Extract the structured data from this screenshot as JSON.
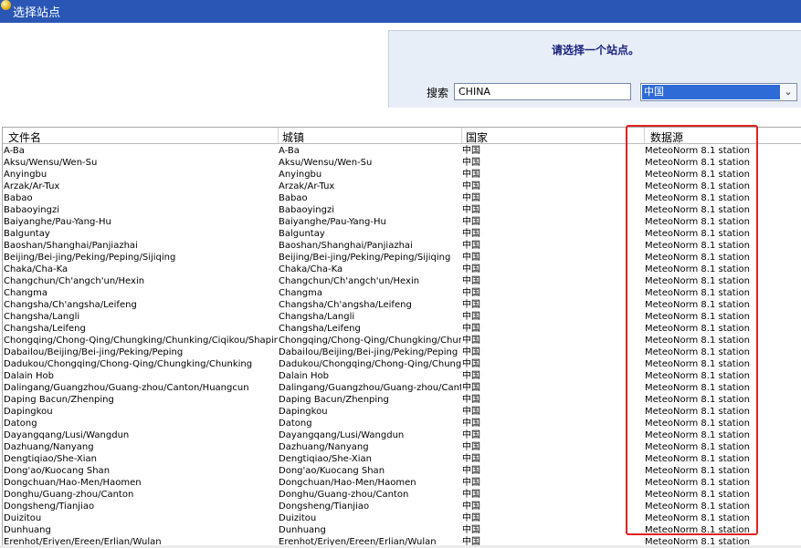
{
  "window": {
    "title": "选择站点",
    "icon": "app-globe-icon"
  },
  "header": {
    "prompt": "请选择一个站点。",
    "search_label": "搜索",
    "search_value": "CHINA",
    "country_selected": "中国"
  },
  "columns": [
    "文件名",
    "城镇",
    "国家",
    "数据源"
  ],
  "rows": [
    [
      "A-Ba",
      "A-Ba",
      "中国",
      "MeteoNorm 8.1 station"
    ],
    [
      "Aksu/Wensu/Wen-Su",
      "Aksu/Wensu/Wen-Su",
      "中国",
      "MeteoNorm 8.1 station"
    ],
    [
      "Anyingbu",
      "Anyingbu",
      "中国",
      "MeteoNorm 8.1 station"
    ],
    [
      "Arzak/Ar-Tux",
      "Arzak/Ar-Tux",
      "中国",
      "MeteoNorm 8.1 station"
    ],
    [
      "Babao",
      "Babao",
      "中国",
      "MeteoNorm 8.1 station"
    ],
    [
      "Babaoyingzi",
      "Babaoyingzi",
      "中国",
      "MeteoNorm 8.1 station"
    ],
    [
      "Baiyanghe/Pau-Yang-Hu",
      "Baiyanghe/Pau-Yang-Hu",
      "中国",
      "MeteoNorm 8.1 station"
    ],
    [
      "Balguntay",
      "Balguntay",
      "中国",
      "MeteoNorm 8.1 station"
    ],
    [
      "Baoshan/Shanghai/Panjiazhai",
      "Baoshan/Shanghai/Panjiazhai",
      "中国",
      "MeteoNorm 8.1 station"
    ],
    [
      "Beijing/Bei-jing/Peking/Peping/Sijiqing",
      "Beijing/Bei-jing/Peking/Peping/Sijiqing",
      "中国",
      "MeteoNorm 8.1 station"
    ],
    [
      "Chaka/Cha-Ka",
      "Chaka/Cha-Ka",
      "中国",
      "MeteoNorm 8.1 station"
    ],
    [
      "Changchun/Ch'angch'un/Hexin",
      "Changchun/Ch'angch'un/Hexin",
      "中国",
      "MeteoNorm 8.1 station"
    ],
    [
      "Changma",
      "Changma",
      "中国",
      "MeteoNorm 8.1 station"
    ],
    [
      "Changsha/Ch'angsha/Leifeng",
      "Changsha/Ch'angsha/Leifeng",
      "中国",
      "MeteoNorm 8.1 station"
    ],
    [
      "Changsha/Langli",
      "Changsha/Langli",
      "中国",
      "MeteoNorm 8.1 station"
    ],
    [
      "Changsha/Leifeng",
      "Changsha/Leifeng",
      "中国",
      "MeteoNorm 8.1 station"
    ],
    [
      "Chongqing/Chong-Qing/Chungking/Chunking/Ciqikou/Shapingba",
      "Chongqing/Chong-Qing/Chungking/Chunking",
      "中国",
      "MeteoNorm 8.1 station"
    ],
    [
      "Dabailou/Beijing/Bei-jing/Peking/Peping",
      "Dabailou/Beijing/Bei-jing/Peking/Peping",
      "中国",
      "MeteoNorm 8.1 station"
    ],
    [
      "Dadukou/Chongqing/Chong-Qing/Chungking/Chunking",
      "Dadukou/Chongqing/Chong-Qing/Chungking",
      "中国",
      "MeteoNorm 8.1 station"
    ],
    [
      "Dalain Hob",
      "Dalain Hob",
      "中国",
      "MeteoNorm 8.1 station"
    ],
    [
      "Dalingang/Guangzhou/Guang-zhou/Canton/Huangcun",
      "Dalingang/Guangzhou/Guang-zhou/Canton",
      "中国",
      "MeteoNorm 8.1 station"
    ],
    [
      "Daping Bacun/Zhenping",
      "Daping Bacun/Zhenping",
      "中国",
      "MeteoNorm 8.1 station"
    ],
    [
      "Dapingkou",
      "Dapingkou",
      "中国",
      "MeteoNorm 8.1 station"
    ],
    [
      "Datong",
      "Datong",
      "中国",
      "MeteoNorm 8.1 station"
    ],
    [
      "Dayangqang/Lusi/Wangdun",
      "Dayangqang/Lusi/Wangdun",
      "中国",
      "MeteoNorm 8.1 station"
    ],
    [
      "Dazhuang/Nanyang",
      "Dazhuang/Nanyang",
      "中国",
      "MeteoNorm 8.1 station"
    ],
    [
      "Dengtiqiao/She-Xian",
      "Dengtiqiao/She-Xian",
      "中国",
      "MeteoNorm 8.1 station"
    ],
    [
      "Dong'ao/Kuocang Shan",
      "Dong'ao/Kuocang Shan",
      "中国",
      "MeteoNorm 8.1 station"
    ],
    [
      "Dongchuan/Hao-Men/Haomen",
      "Dongchuan/Hao-Men/Haomen",
      "中国",
      "MeteoNorm 8.1 station"
    ],
    [
      "Donghu/Guang-zhou/Canton",
      "Donghu/Guang-zhou/Canton",
      "中国",
      "MeteoNorm 8.1 station"
    ],
    [
      "Dongsheng/Tianjiao",
      "Dongsheng/Tianjiao",
      "中国",
      "MeteoNorm 8.1 station"
    ],
    [
      "Duizitou",
      "Duizitou",
      "中国",
      "MeteoNorm 8.1 station"
    ],
    [
      "Dunhuang",
      "Dunhuang",
      "中国",
      "MeteoNorm 8.1 station"
    ],
    [
      "Erenhot/Eriyen/Ereen/Erlian/Wulan",
      "Erenhot/Eriyen/Ereen/Erlian/Wulan",
      "中国",
      "MeteoNorm 8.1 station"
    ]
  ]
}
